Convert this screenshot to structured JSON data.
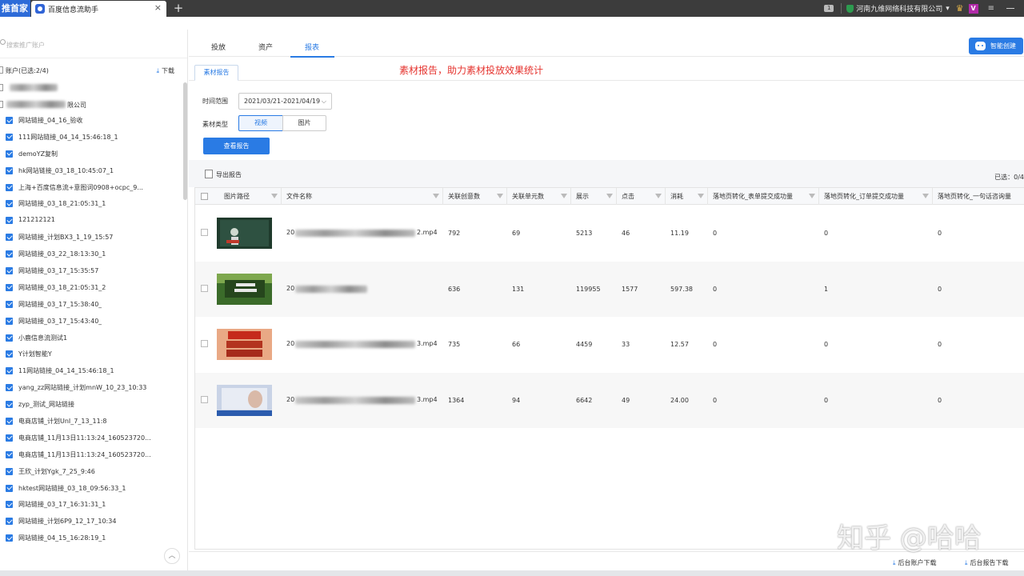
{
  "titlebar": {
    "home_tab": "推首家",
    "app_tab_title": "百度信息流助手",
    "close_glyph": "×",
    "new_tab_glyph": "+",
    "badge": "1",
    "company": "河南九维网络科技有限公司",
    "company_caret": "▾",
    "crown_glyph": "♛",
    "vip": "V",
    "menu_glyph": "≡"
  },
  "sidebar": {
    "search_placeholder": "搜索推广账户",
    "account_header": "账户(已选:2/4)",
    "download_label": "下载",
    "download_icon": "download-icon",
    "company_suffix": "限公司",
    "up_glyph": "︿",
    "items": [
      "网站链接_04_16_验收",
      "111网站链接_04_14_15:46:18_1",
      "demoYZ复制",
      "hk网站链接_03_18_10:45:07_1",
      "上海+百度信息流+意图词0908+ocpc_9...",
      "网站链接_03_18_21:05:31_1",
      "121212121",
      "网站链接_计划BX3_1_19_15:57",
      "网站链接_03_22_18:13:30_1",
      "网站链接_03_17_15:35:57",
      "网站链接_03_18_21:05:31_2",
      "网站链接_03_17_15:38:40_",
      "网站链接_03_17_15:43:40_",
      "小鹿信息流测试1",
      "Y计划智能Y",
      "11网站链接_04_14_15:46:18_1",
      "yang_zz网站链接_计划mnW_10_23_10:33",
      "zyp_测试_网站链接",
      "电商店铺_计划UnI_7_13_11:8",
      "电商店铺_11月13日11:13:24_160523720...",
      "电商店铺_11月13日11:13:24_160523720...",
      "王欣_计划Ygk_7_25_9:46",
      "hktest网站链接_03_18_09:56:33_1",
      "网站链接_03_17_16:31:31_1",
      "网站链接_计划6P9_12_17_10:34",
      "网站链接_04_15_16:28:19_1"
    ]
  },
  "nav": {
    "tabs": [
      "投放",
      "资产",
      "报表"
    ],
    "active_index": 2,
    "smart_create": "智能创建"
  },
  "report": {
    "subtab": "素材报告",
    "note": "素材报告，助力素材投放效果统计",
    "time_label": "时间范围",
    "date_range": "2021/03/21-2021/04/19",
    "date_caret": "⌵",
    "type_label": "素材类型",
    "type_video": "视频",
    "type_image": "图片",
    "query_button": "查看报告",
    "export_label": "导出报告",
    "selected_count": "已选：0/4"
  },
  "table": {
    "columns": [
      "图片路径",
      "文件名称",
      "关联创意数",
      "关联单元数",
      "展示",
      "点击",
      "消耗",
      "落地页转化_表单提交成功量",
      "落地页转化_订单提交成功量",
      "落地页转化_一句话咨询量"
    ],
    "rows": [
      {
        "file_prefix": "20",
        "file_suffix": "2.mp4",
        "creatives": "792",
        "units": "69",
        "impressions": "5213",
        "clicks": "46",
        "cost": "11.19",
        "form": "0",
        "order": "0",
        "consult": "0"
      },
      {
        "file_prefix": "20",
        "file_suffix": "",
        "creatives": "636",
        "units": "131",
        "impressions": "119955",
        "clicks": "1577",
        "cost": "597.38",
        "form": "0",
        "order": "1",
        "consult": "0"
      },
      {
        "file_prefix": "20",
        "file_suffix": "3.mp4",
        "creatives": "735",
        "units": "66",
        "impressions": "4459",
        "clicks": "33",
        "cost": "12.57",
        "form": "0",
        "order": "0",
        "consult": "0"
      },
      {
        "file_prefix": "20",
        "file_suffix": "3.mp4",
        "creatives": "1364",
        "units": "94",
        "impressions": "6642",
        "clicks": "49",
        "cost": "24.00",
        "form": "0",
        "order": "0",
        "consult": "0"
      }
    ],
    "thumb_texts": [
      "",
      "",
      "日均线索\n加盟经营\n找好店子",
      ""
    ]
  },
  "footer": {
    "account_download": "后台账户下载",
    "report_download": "后台报告下载"
  },
  "watermark": "知乎 @哈哈",
  "colors": {
    "accent": "#2a7be4",
    "note_red": "#e5322d",
    "titlebar": "#3c3c3c"
  }
}
